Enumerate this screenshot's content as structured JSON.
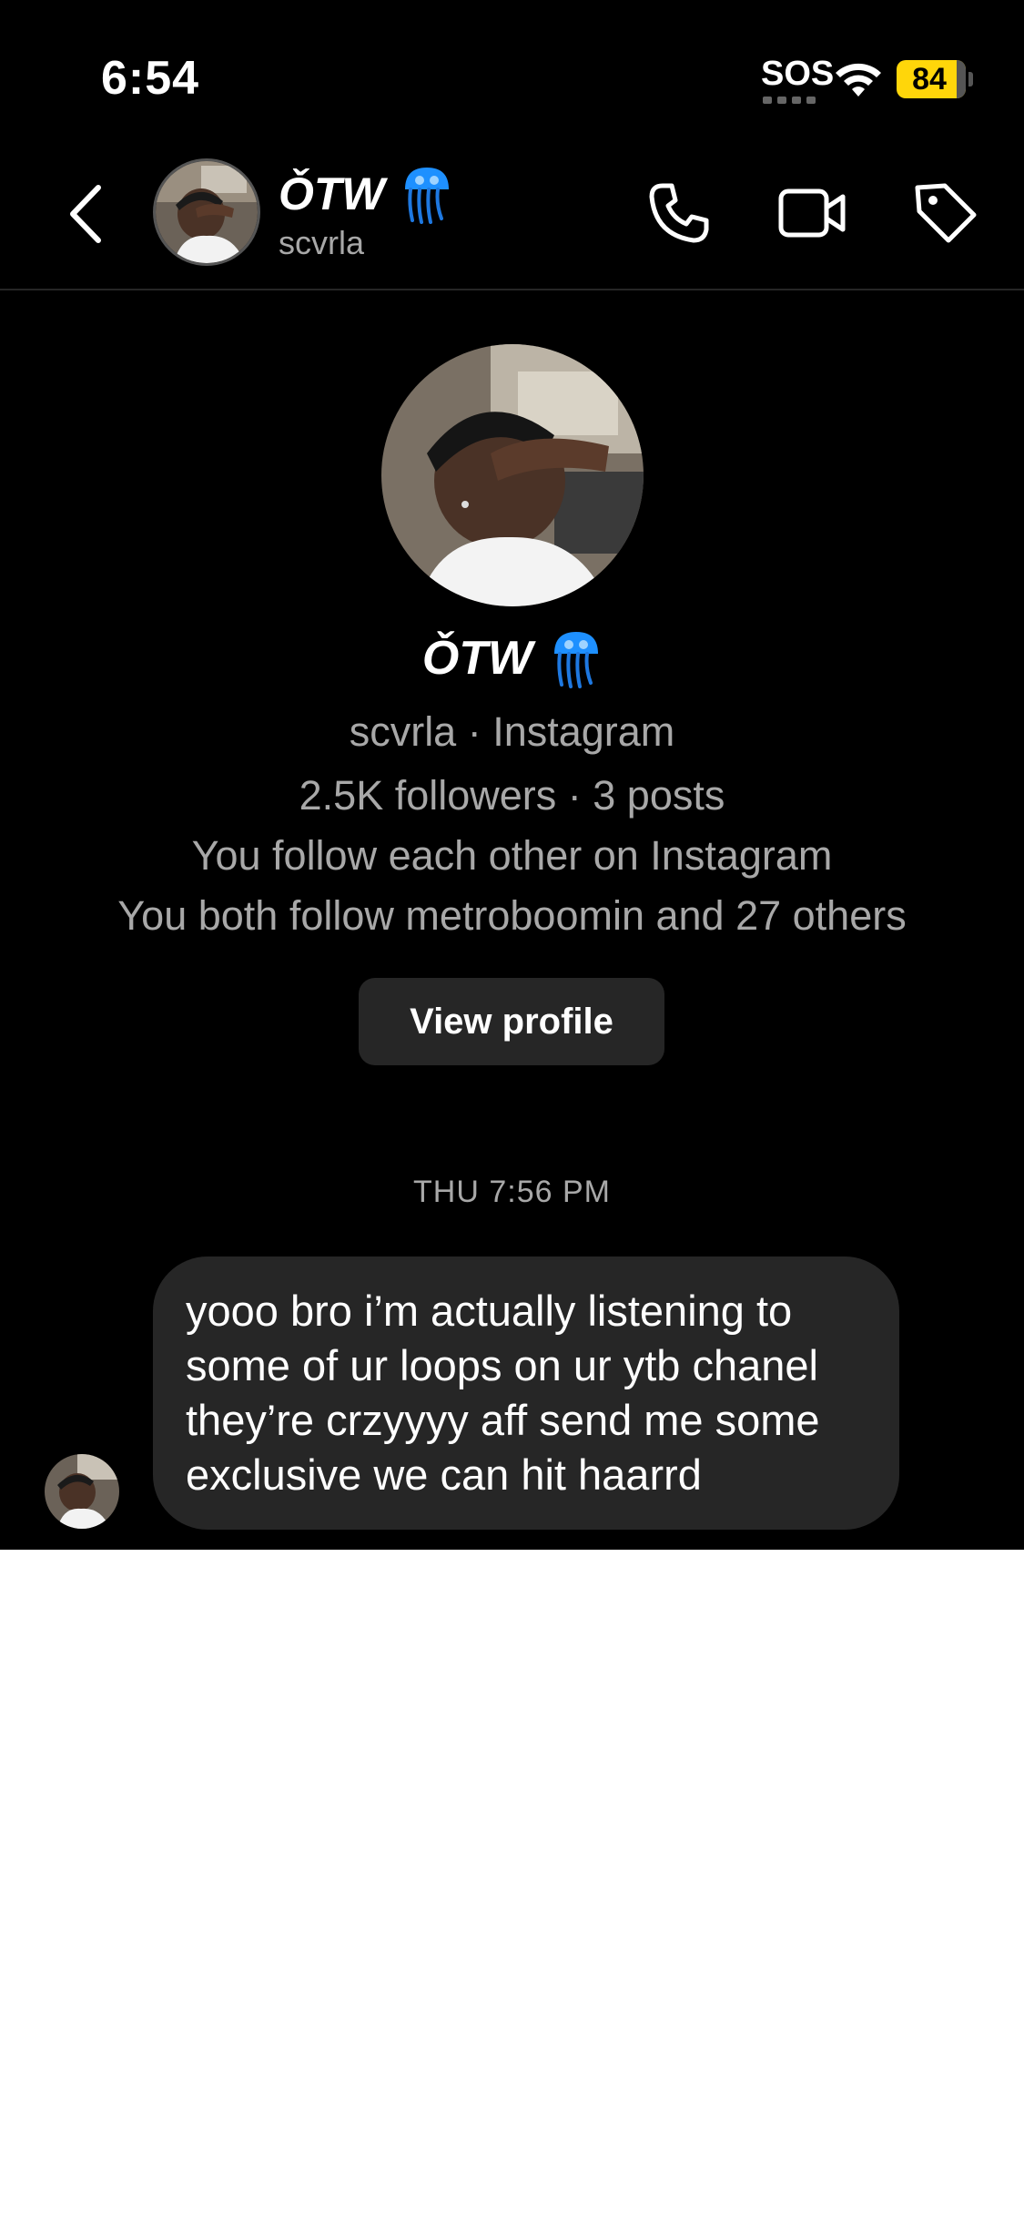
{
  "status_bar": {
    "time": "6:54",
    "sos": "SOS",
    "battery_percent": "84",
    "battery_color": "#ffd60a"
  },
  "header": {
    "name": "ǑTW",
    "username": "scvrla",
    "emoji_icon": "jellyfish-icon",
    "actions": [
      "phone-icon",
      "video-camera-icon",
      "tag-icon"
    ]
  },
  "profile": {
    "name": "ǑTW",
    "handle_line": "scvrla · Instagram",
    "stats_line": "2.5K followers · 3 posts",
    "follow_line": "You follow each other on Instagram",
    "mutual_line": "You both follow metroboomin and 27 others",
    "view_profile_label": "View profile"
  },
  "conversation": {
    "timestamp": "THU 7:56 PM",
    "messages": [
      {
        "from": "other",
        "text": "yooo bro i’m actually listening to some of ur loops on ur ytb chanel they’re crzyyyy aff send me some exclusive we can hit haarrd"
      }
    ]
  },
  "colors": {
    "background": "#000000",
    "secondary_text": "#a8a8a8",
    "bubble": "#262626",
    "jellyfish": "#1e90ff"
  }
}
